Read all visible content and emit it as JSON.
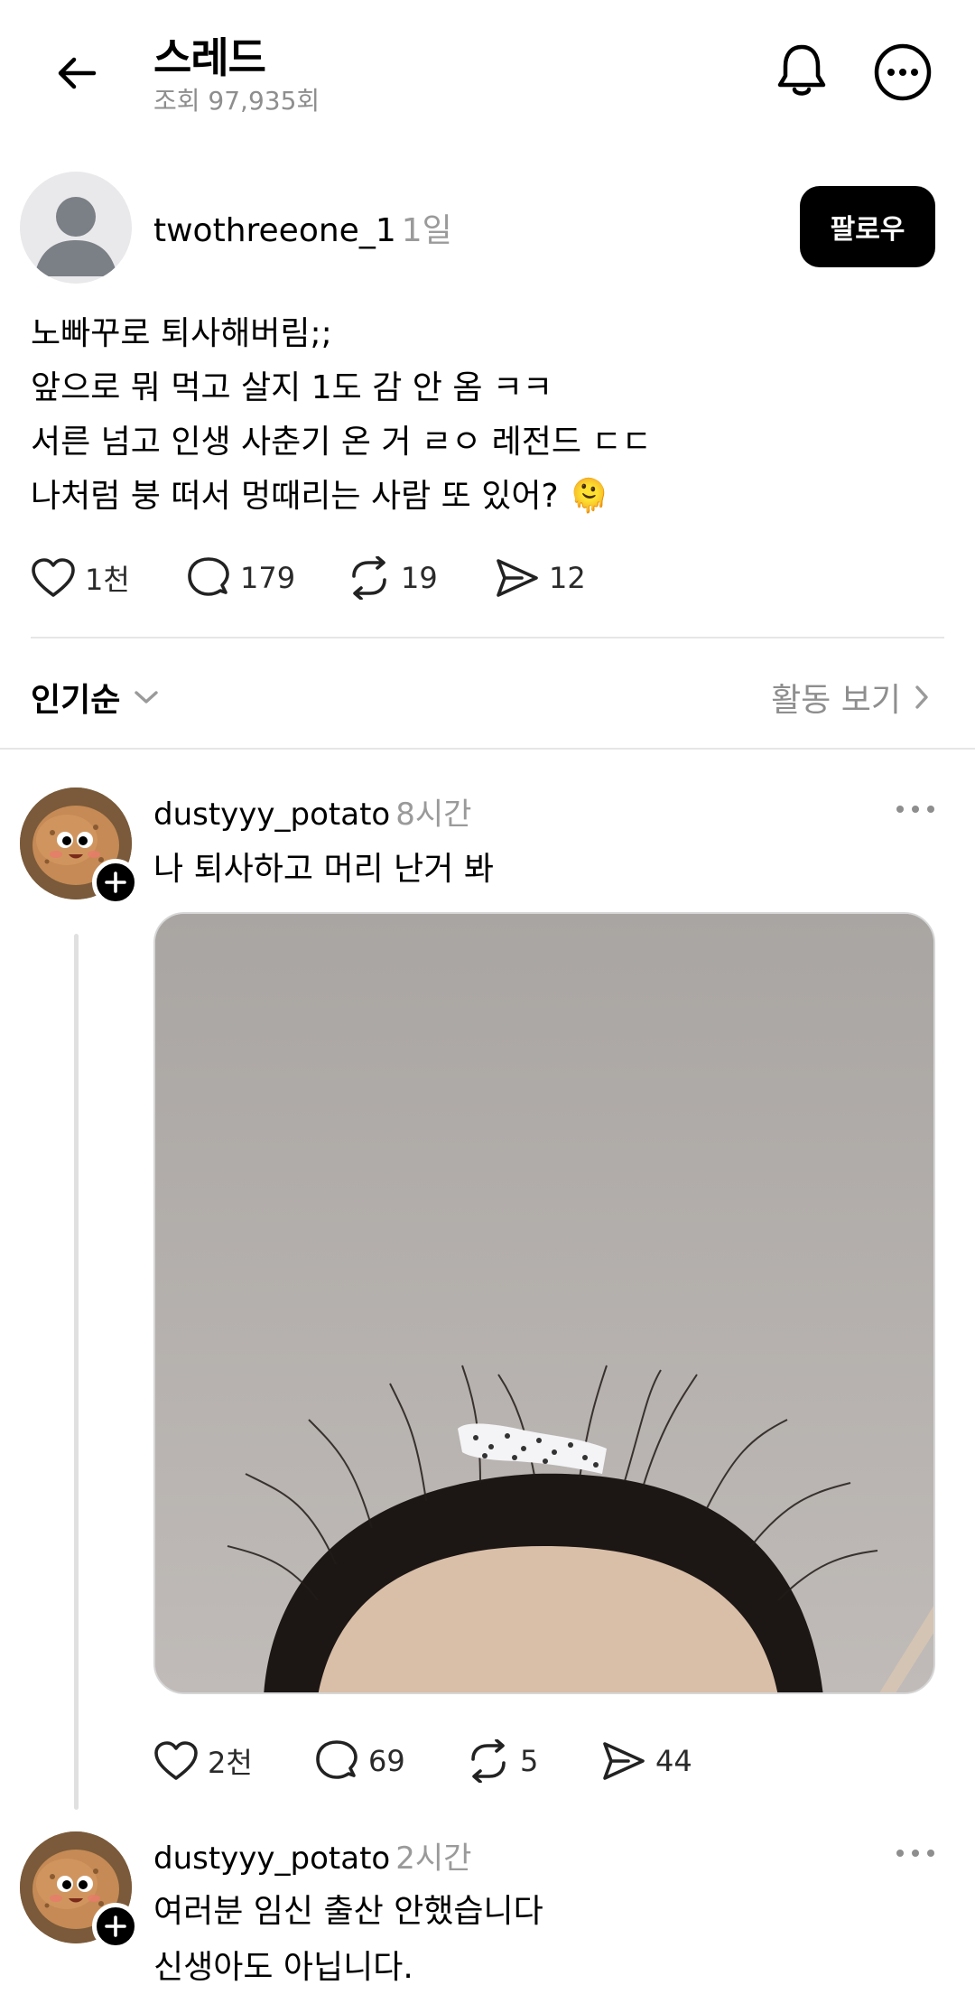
{
  "header": {
    "title": "스레드",
    "views": "조회 97,935회"
  },
  "post": {
    "username": "twothreeone_1",
    "time": "1일",
    "follow_label": "팔로우",
    "lines": [
      "노빠꾸로 퇴사해버림;;",
      "앞으로 뭐 먹고 살지 1도 감 안 옴 ㅋㅋ",
      "서른 넘고 인생 사춘기 온 거 ㄹㅇ 레전드 ㄷㄷ",
      "나처럼 붕 떠서 멍때리는 사람 또 있어? 🫠"
    ],
    "likes": "1천",
    "comments": "179",
    "reposts": "19",
    "shares": "12"
  },
  "sort": {
    "label": "인기순",
    "activity": "활동 보기"
  },
  "replies": [
    {
      "username": "dustyyy_potato",
      "time": "8시간",
      "lines": [
        "나 퇴사하고 머리 난거 봐"
      ],
      "likes": "2천",
      "comments": "69",
      "reposts": "5",
      "shares": "44"
    },
    {
      "username": "dustyyy_potato",
      "time": "2시간",
      "lines": [
        "여러분 임신 출산 안했습니다",
        "신생아도 아닙니다."
      ]
    }
  ],
  "icons": {
    "back": "arrow-left-icon",
    "bell": "bell-icon",
    "more": "more-circle-icon",
    "like": "heart-icon",
    "comment": "comment-icon",
    "repost": "repost-icon",
    "share": "send-icon"
  }
}
